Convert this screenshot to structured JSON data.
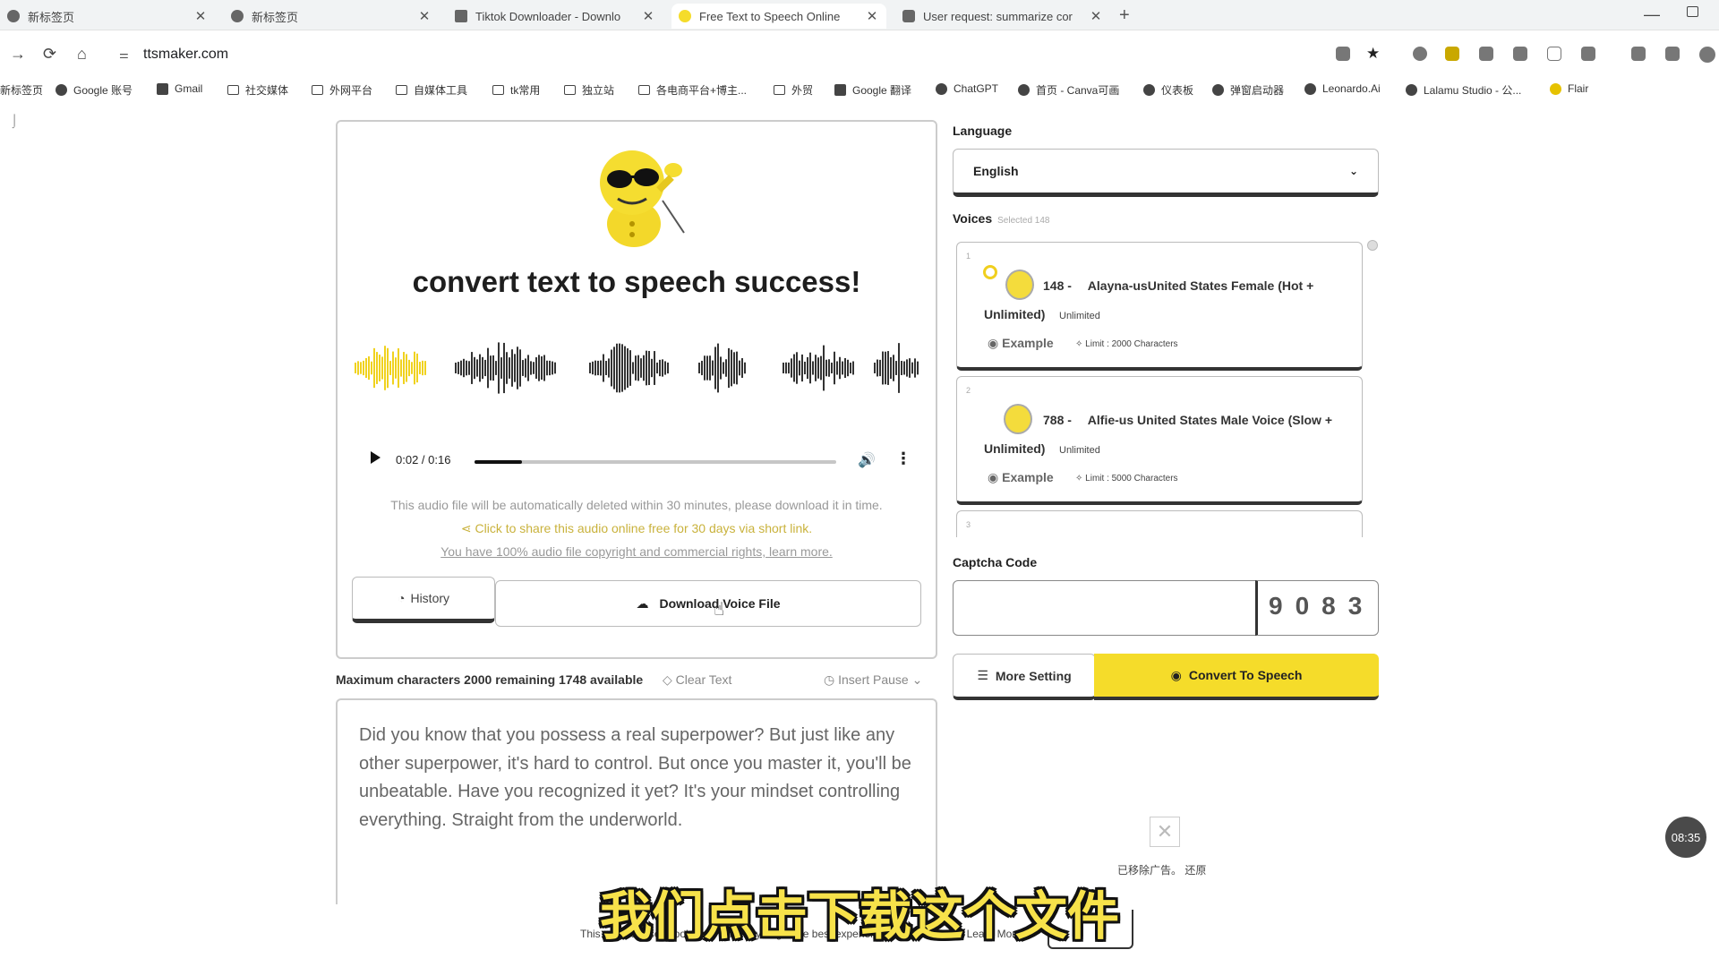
{
  "browser": {
    "tabs": [
      {
        "title": "新标签页",
        "active": false
      },
      {
        "title": "新标签页",
        "active": false
      },
      {
        "title": "Tiktok Downloader - Downlo",
        "active": false
      },
      {
        "title": "Free Text to Speech Online",
        "active": true
      },
      {
        "title": "User request: summarize cor",
        "active": false
      }
    ],
    "new_tab_label": "+",
    "url": "ttsmaker.com",
    "bookmarks": [
      "新标签页",
      "Google 账号",
      "Gmail",
      "社交媒体",
      "外网平台",
      "自媒体工具",
      "tk常用",
      "独立站",
      "各电商平台+博主...",
      "外贸",
      "Google 翻译",
      "ChatGPT",
      "首页 - Canva可画",
      "仪表板",
      "弹窗启动器",
      "Leonardo.Ai",
      "Lalamu Studio - 公...",
      "Flair"
    ]
  },
  "result": {
    "title": "convert text to speech success!",
    "audio": {
      "time": "0:02 / 0:16",
      "progress": 0.13
    },
    "notes": [
      "This audio file will be automatically deleted within 30 minutes, please download it in time.",
      "Click to share this audio online free for 30 days via short link.",
      "You have 100% audio file copyright and commercial rights, learn more."
    ],
    "history_label": "History",
    "download_label": "Download Voice File"
  },
  "editor": {
    "counter": "Maximum characters 2000 remaining 1748 available",
    "clear_label": "Clear Text",
    "insert_pause_label": "Insert Pause",
    "text": "Did you know that you possess a real superpower? But just like any other superpower, it's hard to control. But once you master it, you'll be unbeatable. Have you recognized it yet? It's your mindset controlling everything. Straight from the underworld."
  },
  "settings": {
    "language_label": "Language",
    "language_value": "English",
    "voices_label": "Voices",
    "voices_selected": "Selected  148",
    "voices": [
      {
        "index": "1",
        "name": "148 -  Alayna-usUnited States Female (Hot +",
        "name2": "Unlimited)",
        "unlimited": "Unlimited",
        "example": "Example",
        "limit": "Limit : 2000 Characters"
      },
      {
        "index": "2",
        "name": "788 -  Alfie-us United States Male Voice (Slow +",
        "name2": "Unlimited)",
        "unlimited": "Unlimited",
        "example": "Example",
        "limit": "Limit : 5000 Characters"
      },
      {
        "index": "3"
      }
    ],
    "captcha_label": "Captcha Code",
    "captcha_text": "9083",
    "more_setting_label": "More Setting",
    "convert_label": "Convert To Speech"
  },
  "ad_removed_text": "已移除广告。 还原",
  "cookie_text": "This website uses cookies to ensure you get the best experience on our website. Learn More",
  "cookie_button": "Got it!",
  "clock": "08:35",
  "subtitle": "我们点击下载这个文件",
  "colors": {
    "accent": "#f5dc2a",
    "waveform_played": "#f0d21e",
    "waveform": "#333333"
  }
}
